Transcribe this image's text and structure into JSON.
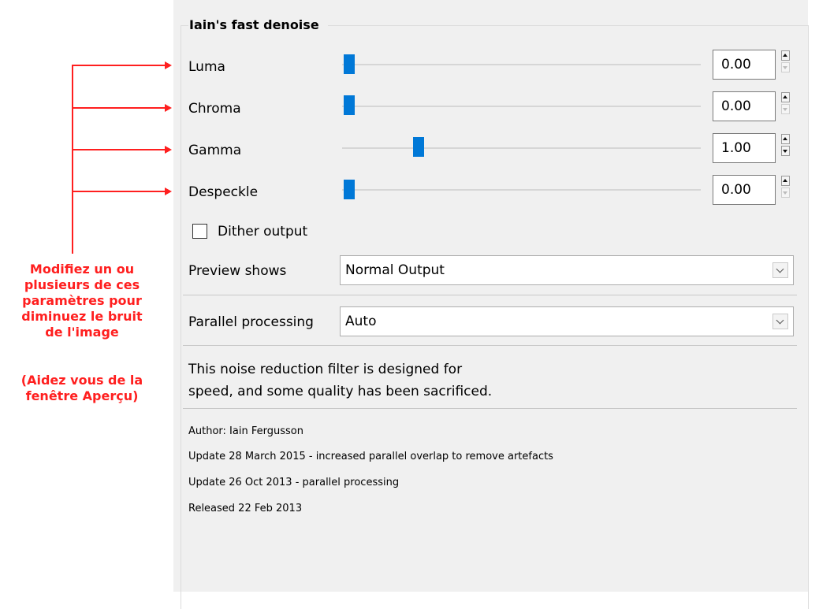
{
  "annotation": {
    "note_main": "Modifiez un ou\nplusieurs de ces\nparamètres pour\ndiminuez le bruit\nde l'image",
    "note_secondary": "(Aidez vous de la\nfenêtre Aperçu)",
    "color": "#ff1f1f"
  },
  "filter": {
    "title": "Iain's fast denoise",
    "params": [
      {
        "label": "Luma",
        "value": "0.00"
      },
      {
        "label": "Chroma",
        "value": "0.00"
      },
      {
        "label": "Gamma",
        "value": "1.00"
      },
      {
        "label": "Despeckle",
        "value": "0.00"
      }
    ],
    "dither_label": "Dither output",
    "dither_checked": false,
    "preview_label": "Preview shows",
    "preview_value": "Normal Output",
    "parallel_label": "Parallel processing",
    "parallel_value": "Auto",
    "description": "This noise reduction filter is designed for\nspeed, and some quality has been sacrificed.",
    "info": [
      "Author: Iain Fergusson",
      "Update 28 March 2015 - increased parallel overlap to remove artefacts",
      "Update 26 Oct 2013 - parallel processing",
      "Released 22 Feb 2013"
    ],
    "accent_color": "#0078d7"
  }
}
